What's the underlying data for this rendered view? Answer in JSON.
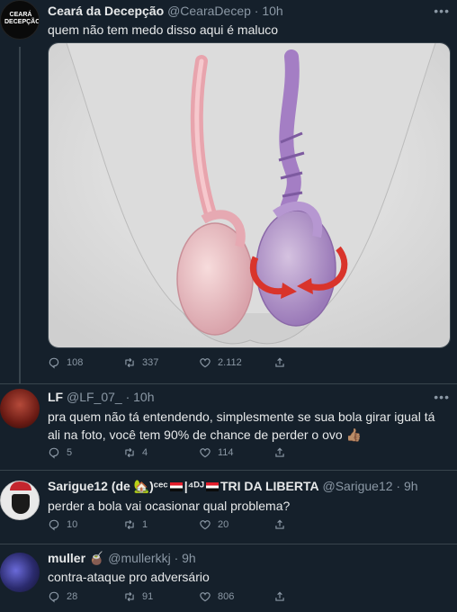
{
  "tweets": [
    {
      "name": "Ceará da Decepção",
      "handle": "@CearaDecep",
      "time": "· 10h",
      "text": "quem não tem medo disso aqui é maluco",
      "avatar_text": "CEARÁ DECEPÇÃO",
      "replies": "108",
      "retweets": "337",
      "likes": "2.112"
    },
    {
      "name": "LF",
      "handle": "@LF_07_",
      "time": "· 10h",
      "text": "pra quem não tá entendendo, simplesmente se sua bola girar igual tá ali na foto, você tem 90% de chance de perder o ovo 👍🏽",
      "replies": "5",
      "retweets": "4",
      "likes": "114"
    },
    {
      "name_prefix": "Sarigue12 (de ",
      "name_mid": ")ᶜᵉᶜ",
      "name_sup": "|⁴ᴰᴶ",
      "name_suffix": "TRI DA LIBERTA",
      "handle": "@Sarigue12",
      "time": "· 9h",
      "text": "perder a bola vai ocasionar qual problema?",
      "replies": "10",
      "retweets": "1",
      "likes": "20"
    },
    {
      "name": "muller",
      "name_emoji": "🧉",
      "handle": "@mullerkkj",
      "time": "· 9h",
      "text": "contra-ataque pro adversário",
      "replies": "28",
      "retweets": "91",
      "likes": "806"
    }
  ],
  "icons": {
    "more": "more-horizontal-icon",
    "reply": "reply-icon",
    "retweet": "retweet-icon",
    "like": "heart-icon",
    "share": "share-icon"
  },
  "colors": {
    "background": "#15202b",
    "text": "#e7e9ea",
    "muted": "#8b98a5",
    "border": "#38444d"
  }
}
